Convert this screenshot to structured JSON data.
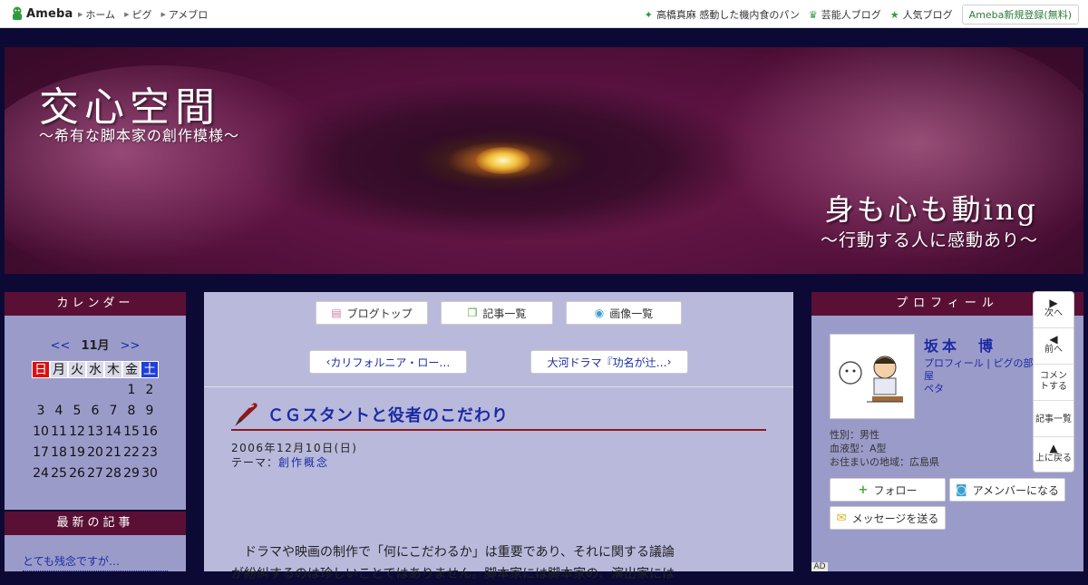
{
  "topbar": {
    "logo_text": "Ameba",
    "nav": [
      "ホーム",
      "ピグ",
      "アメブロ"
    ],
    "right_links": [
      "高橋真麻 感動した機内食のパン",
      "芸能人ブログ",
      "人気ブログ"
    ],
    "register_label": "Ameba新規登録(無料)"
  },
  "header": {
    "title": "交心空間",
    "subtitle": "〜希有な脚本家の創作模様〜",
    "slogan": "身も心も動ing",
    "slogan2": "〜行動する人に感動あり〜"
  },
  "calendar": {
    "heading": "カレンダー",
    "prev": "<<",
    "month": "11月",
    "next": ">>",
    "weekdays": [
      "日",
      "月",
      "火",
      "水",
      "木",
      "金",
      "土"
    ],
    "days": [
      "",
      "",
      "",
      "",
      "",
      "1",
      "2",
      "3",
      "4",
      "5",
      "6",
      "7",
      "8",
      "9",
      "10",
      "11",
      "12",
      "13",
      "14",
      "15",
      "16",
      "17",
      "18",
      "19",
      "20",
      "21",
      "22",
      "23",
      "24",
      "25",
      "26",
      "27",
      "28",
      "29",
      "30"
    ]
  },
  "recent": {
    "heading": "最新の記事",
    "first": "とても残念ですが…"
  },
  "tabs": {
    "top": "ブログトップ",
    "list": "記事一覧",
    "images": "画像一覧"
  },
  "pager": {
    "prev": "カリフォルニア・ロー…",
    "next": "大河ドラマ『功名が辻…"
  },
  "article": {
    "title": "ＣＧスタントと役者のこだわり",
    "date": "2006年12月10日(日)",
    "theme_label": "テーマ：",
    "theme": "創作概念",
    "body_line1": "ドラマや映画の制作で「何にこだわるか」は重要であり、それに関する議論",
    "body_line2": "が紛糾するのは珍しいことではありません。脚本家には脚本家の、演出家には"
  },
  "profile": {
    "heading": "プロフィール",
    "name": "坂本　博",
    "link_profile": "プロフィール",
    "link_sep": "|",
    "link_pig": "ピグの部屋",
    "link_peta": "ペタ",
    "gender": "性別：男性",
    "blood": "血液型：A型",
    "area": "お住まいの地域：広島県",
    "follow": "フォロー",
    "amember": "アメンバーになる",
    "message": "メッセージを送る"
  },
  "floatnav": {
    "next": "次へ",
    "prev": "前へ",
    "comment": "コメントする",
    "list": "記事一覧",
    "top": "上に戻る"
  },
  "ad_label": "AD",
  "colors": {
    "page_bg": "#0c0a35",
    "panel": "#9b9bca",
    "heading": "#5a1034",
    "link": "#1a2ba3",
    "sunday": "#e01010",
    "saturday": "#1f3fd6"
  }
}
